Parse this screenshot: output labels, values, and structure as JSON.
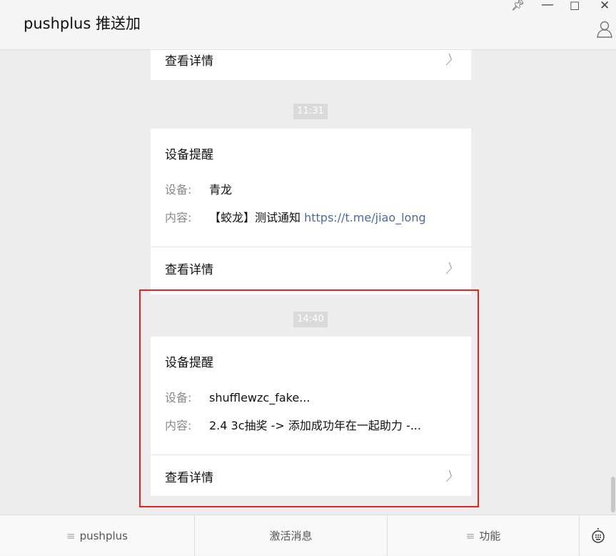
{
  "window": {
    "title": "pushplus 推送加",
    "icons": [
      "pin-icon",
      "minimize-icon",
      "maximize-icon",
      "close-icon",
      "user-icon"
    ]
  },
  "messages": [
    {
      "detail_label": "查看详情"
    },
    {
      "time": "11:31",
      "title": "设备提醒",
      "device_label": "设备:",
      "device": "青龙",
      "content_label": "内容:",
      "content": "【蛟龙】测试通知 ",
      "content_link": "https://t.me/jiao_long",
      "detail_label": "查看详情"
    },
    {
      "time": "14:40",
      "title": "设备提醒",
      "device_label": "设备:",
      "device": "shufflewzc_fake...",
      "content_label": "内容:",
      "content": "2.4 3c抽奖 -> 添加成功年在一起助力 -...",
      "detail_label": "查看详情",
      "highlighted": true
    }
  ],
  "highlight_color": "#e8241c",
  "footer": {
    "menu1": "pushplus",
    "menu2": "激活消息",
    "menu3": "功能",
    "keyboard_icon": "keyboard-icon"
  }
}
